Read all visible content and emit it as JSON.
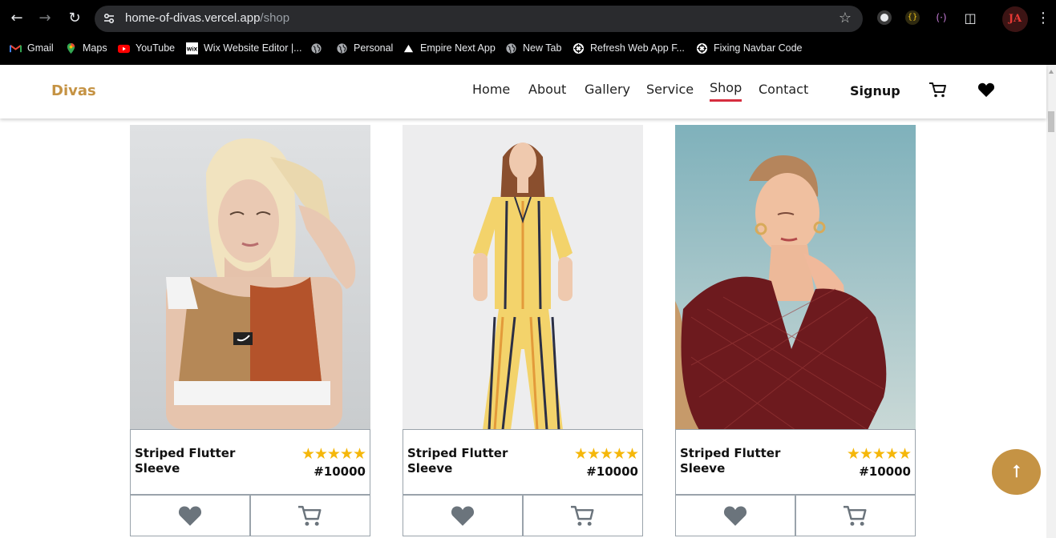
{
  "browser": {
    "url_host": "home-of-divas.vercel.app",
    "url_path": "/shop",
    "profile_initials": "JA",
    "bookmarks": [
      {
        "label": "Gmail",
        "icon": "gmail-icon"
      },
      {
        "label": "Maps",
        "icon": "maps-icon"
      },
      {
        "label": "YouTube",
        "icon": "youtube-icon"
      },
      {
        "label": "Wix Website Editor |...",
        "icon": "wix-icon"
      },
      {
        "label": "",
        "icon": "globe-icon"
      },
      {
        "label": "Personal",
        "icon": "globe-icon"
      },
      {
        "label": "Empire Next App",
        "icon": "triangle-icon"
      },
      {
        "label": "New Tab",
        "icon": "globe-icon"
      },
      {
        "label": "Refresh Web App F...",
        "icon": "chatgpt-icon"
      },
      {
        "label": "Fixing Navbar Code",
        "icon": "chatgpt-icon"
      }
    ]
  },
  "header": {
    "logo": "Divas",
    "menu": [
      "Home",
      "About",
      "Gallery",
      "Service",
      "Shop",
      "Contact"
    ],
    "active": "Shop",
    "signup": "Signup"
  },
  "products": [
    {
      "name": "Striped Flutter Sleeve",
      "rating": 5,
      "stars": "★★★★★",
      "price": "#10000"
    },
    {
      "name": "Striped Flutter Sleeve",
      "rating": 5,
      "stars": "★★★★★",
      "price": "#10000"
    },
    {
      "name": "Striped Flutter Sleeve",
      "rating": 5,
      "stars": "★★★★★",
      "price": "#10000"
    }
  ],
  "colors": {
    "brand": "#c59344",
    "active_underline": "#d62d3f",
    "star": "#f5b70a",
    "action_icon": "#6b747c"
  },
  "back_to_top": "⭡"
}
